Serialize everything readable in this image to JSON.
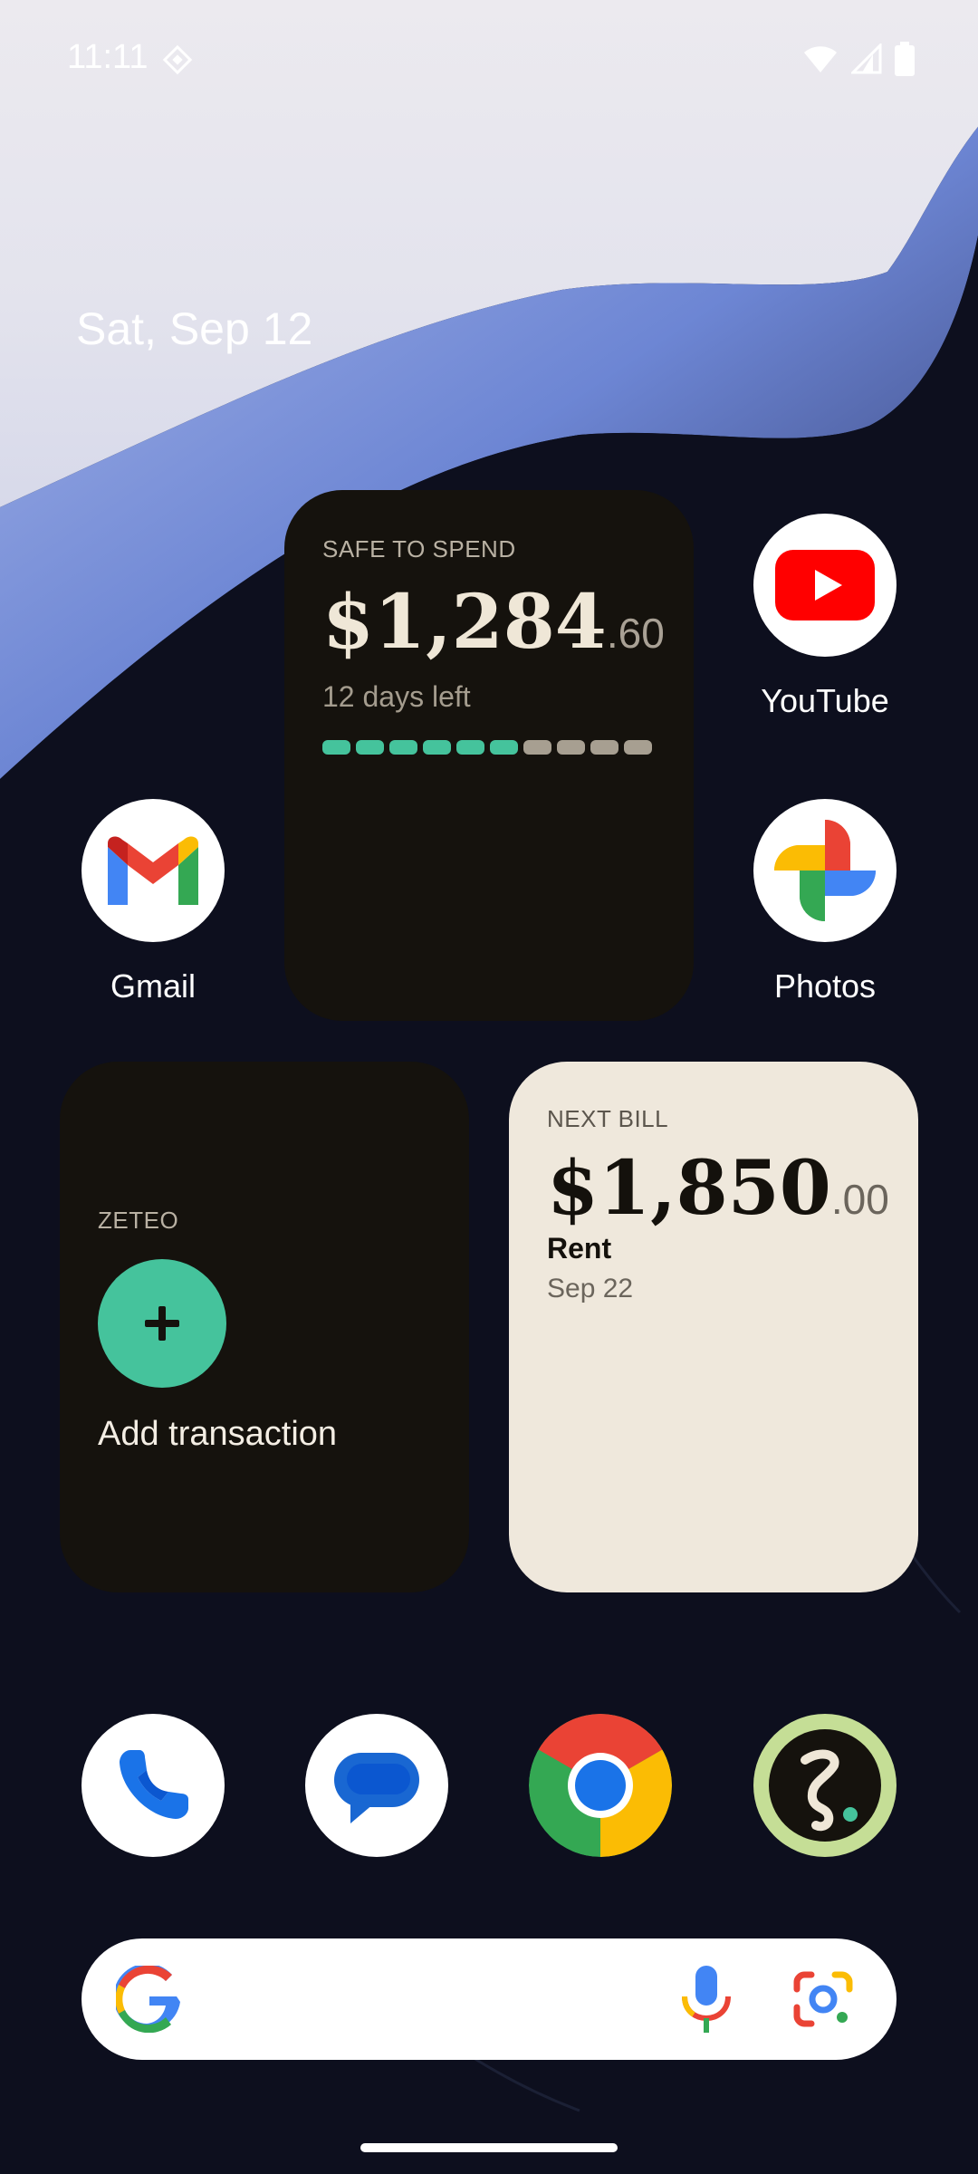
{
  "status_bar": {
    "time": "11:11"
  },
  "home": {
    "date": "Sat, Sep 12"
  },
  "widgets": {
    "safe_to_spend": {
      "label": "SAFE TO SPEND",
      "amount_main": "$1,284",
      "amount_cents": ".60",
      "days_left": "12 days left",
      "progress": {
        "filled": 6,
        "total": 10
      }
    },
    "zeteo": {
      "label": "ZETEO",
      "action_label": "Add transaction"
    },
    "next_bill": {
      "label": "NEXT BILL",
      "amount_main": "$1,850",
      "amount_cents": ".00",
      "name": "Rent",
      "date": "Sep 22"
    }
  },
  "apps": {
    "youtube": "YouTube",
    "gmail": "Gmail",
    "photos": "Photos"
  },
  "dock": [
    "Phone",
    "Messages",
    "Chrome",
    "Zeteo"
  ],
  "colors": {
    "widget_dark": "#15120d",
    "widget_light": "#efe8dc",
    "accent_green": "#45c39c",
    "segment_off": "#a79f91"
  }
}
